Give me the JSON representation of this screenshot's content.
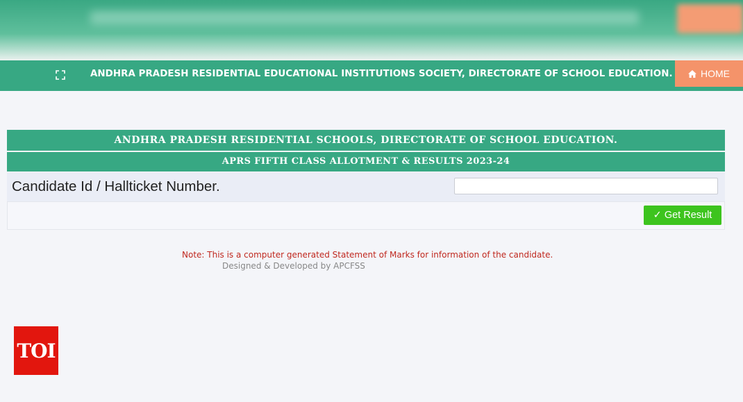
{
  "header": {
    "title": "ANDHRA PRADESH RESIDENTIAL EDUCATIONAL INSTITUTIONS SOCIETY, DIRECTORATE OF SCHOOL EDUCATION.",
    "home_label": "HOME"
  },
  "panel": {
    "heading": "ANDHRA PRADESH RESIDENTIAL SCHOOLS, DIRECTORATE OF SCHOOL EDUCATION.",
    "subheading": "APRS FIFTH CLASS ALLOTMENT & RESULTS 2023-24",
    "candidate_label": "Candidate Id / Hallticket Number.",
    "candidate_value": "",
    "button_label": "✓ Get Result"
  },
  "footer": {
    "note": "Note: This is a computer generated Statement of Marks for information of the candidate.",
    "credit": "Designed & Developed by APCFSS"
  },
  "watermark": {
    "logo": "TOI"
  },
  "colors": {
    "green": "#37a883",
    "home_orange": "#f4936a",
    "button_green": "#3dc41e",
    "note_red": "#c0281e"
  }
}
